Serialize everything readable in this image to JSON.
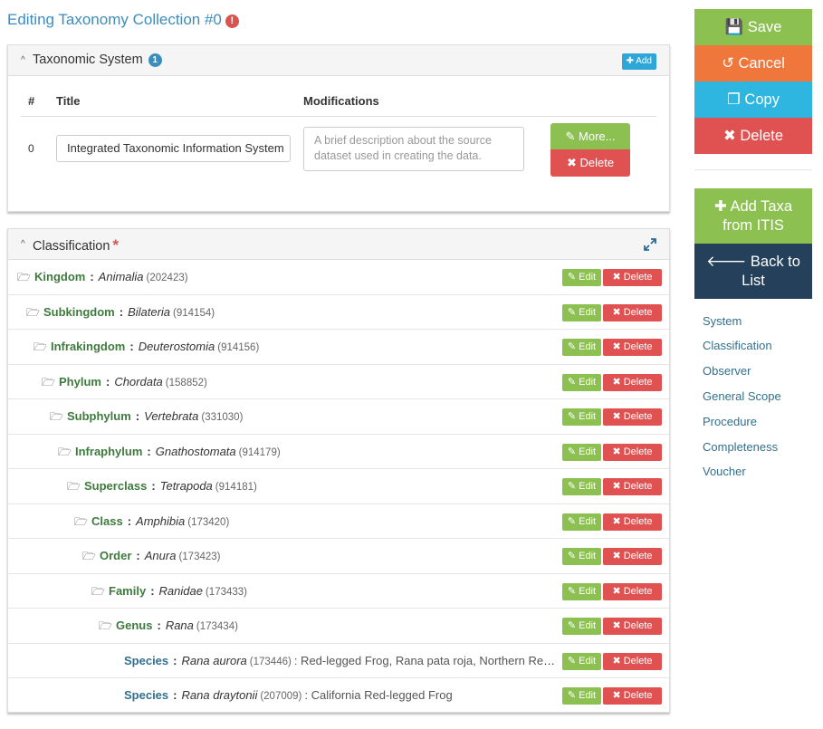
{
  "page": {
    "title": "Editing Taxonomy Collection #0",
    "warn_glyph": "!"
  },
  "taxonomic_system": {
    "heading": "Taxonomic System",
    "count": "1",
    "add_label": "Add",
    "columns": [
      "#",
      "Title",
      "Modifications"
    ],
    "rows": [
      {
        "num": "0",
        "title": "Integrated Taxonomic Information System",
        "modifications_placeholder": "A brief description about the source dataset used in creating the data.",
        "more_label": "More...",
        "delete_label": "Delete"
      }
    ]
  },
  "classification": {
    "heading": "Classification",
    "required_mark": "*",
    "edit_label": "Edit",
    "delete_label": "Delete",
    "nodes": [
      {
        "rank": "Kingdom",
        "name": "Animalia",
        "tsn": "(202423)"
      },
      {
        "rank": "Subkingdom",
        "name": "Bilateria",
        "tsn": "(914154)"
      },
      {
        "rank": "Infrakingdom",
        "name": "Deuterostomia",
        "tsn": "(914156)"
      },
      {
        "rank": "Phylum",
        "name": "Chordata",
        "tsn": "(158852)"
      },
      {
        "rank": "Subphylum",
        "name": "Vertebrata",
        "tsn": "(331030)"
      },
      {
        "rank": "Infraphylum",
        "name": "Gnathostomata",
        "tsn": "(914179)"
      },
      {
        "rank": "Superclass",
        "name": "Tetrapoda",
        "tsn": "(914181)"
      },
      {
        "rank": "Class",
        "name": "Amphibia",
        "tsn": "(173420)"
      },
      {
        "rank": "Order",
        "name": "Anura",
        "tsn": "(173423)"
      },
      {
        "rank": "Family",
        "name": "Ranidae",
        "tsn": "(173433)"
      },
      {
        "rank": "Genus",
        "name": "Rana",
        "tsn": "(173434)"
      },
      {
        "rank": "Species",
        "name": "Rana aurora",
        "tsn": "(173446)",
        "common": ": Red-legged Frog, Rana pata roja, Northern Red-legged Frog"
      },
      {
        "rank": "Species",
        "name": "Rana draytonii",
        "tsn": "(207009)",
        "common": ": California Red-legged Frog"
      }
    ]
  },
  "sidebar": {
    "save_label": "Save",
    "cancel_label": "Cancel",
    "copy_label": "Copy",
    "delete_label": "Delete",
    "add_taxa_label_1": "Add Taxa",
    "add_taxa_label_2": "from ITIS",
    "back_label_1": "Back to",
    "back_label_2": "List",
    "nav": [
      "System",
      "Classification",
      "Observer",
      "General Scope",
      "Procedure",
      "Completeness",
      "Voucher"
    ]
  },
  "colors": {
    "accent": "#3c8dbc",
    "success": "#8cc152",
    "warning": "#f0773c",
    "info": "#2eb6e0",
    "danger": "#e05252",
    "dark": "#24405a"
  }
}
